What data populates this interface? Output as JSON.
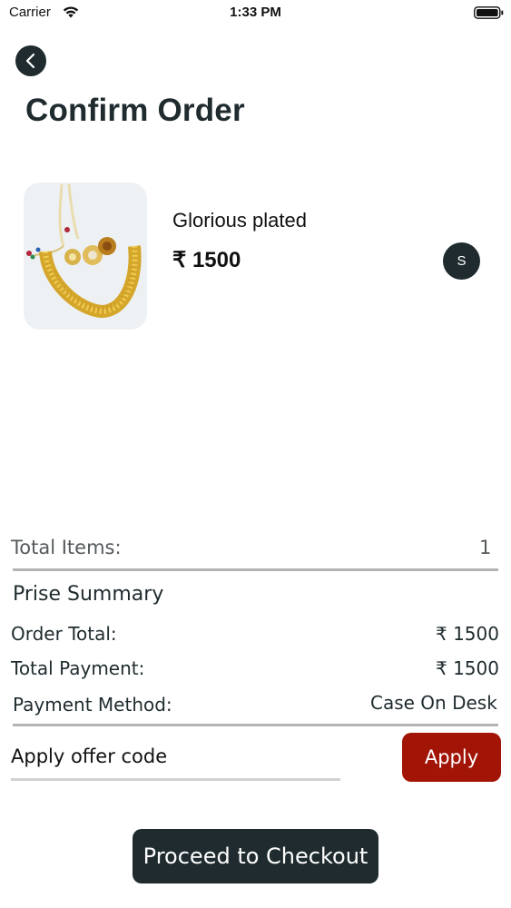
{
  "status_bar": {
    "carrier": "Carrier",
    "time": "1:33 PM"
  },
  "header": {
    "title": "Confirm Order"
  },
  "product": {
    "name": "Glorious plated",
    "price": "₹ 1500",
    "size": "S"
  },
  "summary": {
    "total_items_label": "Total Items:",
    "total_items_value": "1",
    "heading": "Prise Summary",
    "order_total_label": "Order Total:",
    "order_total_value": "₹ 1500",
    "total_payment_label": "Total Payment:",
    "total_payment_value": "₹ 1500",
    "payment_method_label": "Payment Method:",
    "payment_method_value": "Case On Desk"
  },
  "offer": {
    "placeholder": "Apply offer code",
    "apply_label": "Apply"
  },
  "checkout": {
    "label": "Proceed to Checkout"
  },
  "colors": {
    "primary_dark": "#1f2b2e",
    "apply_red": "#a11406"
  }
}
